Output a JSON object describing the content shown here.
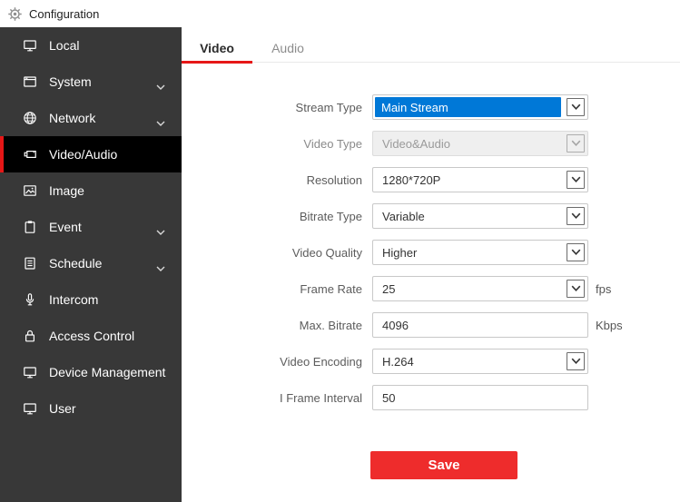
{
  "header": {
    "title": "Configuration"
  },
  "sidebar": {
    "items": [
      {
        "label": "Local",
        "icon": "monitor-icon",
        "active": false,
        "expandable": false
      },
      {
        "label": "System",
        "icon": "system-window-icon",
        "active": false,
        "expandable": true
      },
      {
        "label": "Network",
        "icon": "globe-icon",
        "active": false,
        "expandable": true
      },
      {
        "label": "Video/Audio",
        "icon": "video-camera-icon",
        "active": true,
        "expandable": false
      },
      {
        "label": "Image",
        "icon": "image-icon",
        "active": false,
        "expandable": false
      },
      {
        "label": "Event",
        "icon": "clipboard-icon",
        "active": false,
        "expandable": true
      },
      {
        "label": "Schedule",
        "icon": "schedule-list-icon",
        "active": false,
        "expandable": true
      },
      {
        "label": "Intercom",
        "icon": "microphone-icon",
        "active": false,
        "expandable": false
      },
      {
        "label": "Access Control",
        "icon": "lock-icon",
        "active": false,
        "expandable": false
      },
      {
        "label": "Device Management",
        "icon": "monitor-icon",
        "active": false,
        "expandable": false
      },
      {
        "label": "User",
        "icon": "monitor-icon",
        "active": false,
        "expandable": false
      }
    ]
  },
  "tabs": [
    {
      "label": "Video",
      "active": true
    },
    {
      "label": "Audio",
      "active": false
    }
  ],
  "form": {
    "fields": [
      {
        "label": "Stream Type",
        "value": "Main Stream",
        "type": "select",
        "state": "text-selected",
        "unit": ""
      },
      {
        "label": "Video Type",
        "value": "Video&Audio",
        "type": "select",
        "state": "disabled",
        "unit": ""
      },
      {
        "label": "Resolution",
        "value": "1280*720P",
        "type": "select",
        "state": "normal",
        "unit": ""
      },
      {
        "label": "Bitrate Type",
        "value": "Variable",
        "type": "select",
        "state": "normal",
        "unit": ""
      },
      {
        "label": "Video Quality",
        "value": "Higher",
        "type": "select",
        "state": "normal",
        "unit": ""
      },
      {
        "label": "Frame Rate",
        "value": "25",
        "type": "select",
        "state": "normal",
        "unit": "fps"
      },
      {
        "label": "Max. Bitrate",
        "value": "4096",
        "type": "input",
        "state": "normal",
        "unit": "Kbps"
      },
      {
        "label": "Video Encoding",
        "value": "H.264",
        "type": "select",
        "state": "normal",
        "unit": ""
      },
      {
        "label": "I Frame Interval",
        "value": "50",
        "type": "input",
        "state": "normal",
        "unit": ""
      }
    ],
    "save_label": "Save"
  },
  "colors": {
    "accent_red": "#e61717",
    "save_button_red": "#ee2c2c",
    "selection_blue": "#0078d7",
    "sidebar_bg": "#383838",
    "active_item_bg": "#000000"
  }
}
